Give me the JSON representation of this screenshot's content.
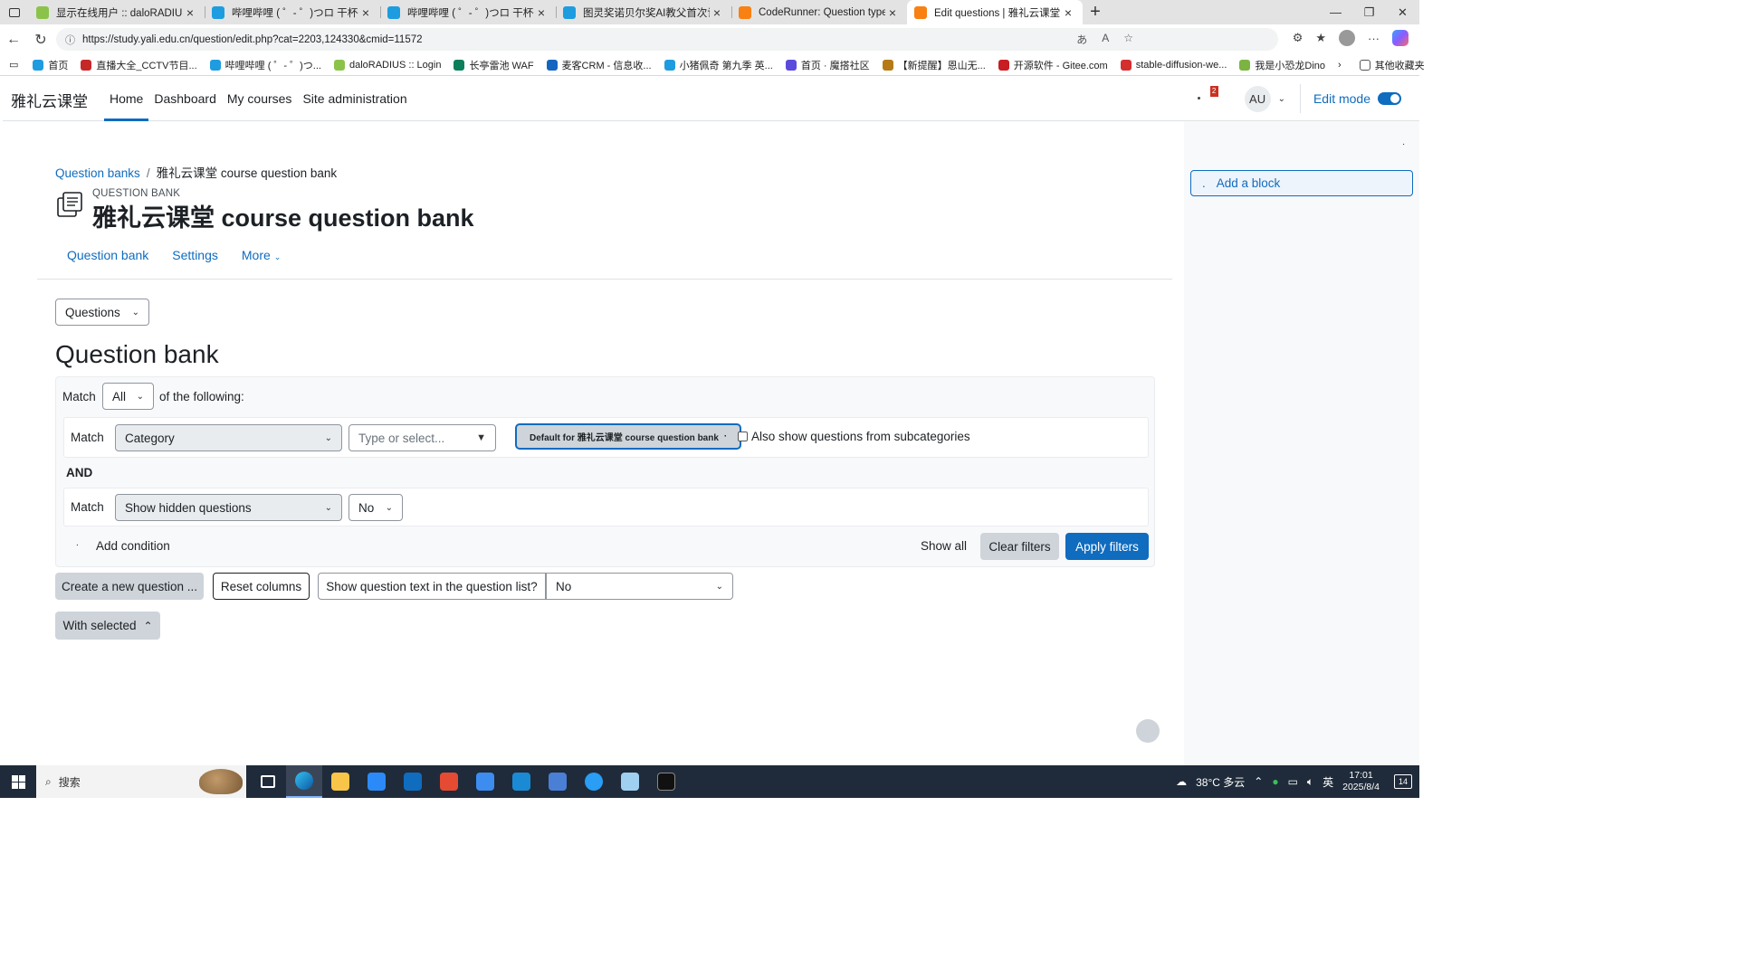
{
  "browser": {
    "tabs": [
      {
        "title": "显示在线用户 :: daloRADIUS",
        "color": "#8bc34a",
        "active": false
      },
      {
        "title": "哔哩哔哩 ( ゜- ゜)つロ 干杯~-bilib",
        "color": "#1e9ce0",
        "active": false
      },
      {
        "title": "哔哩哔哩 ( ゜- ゜)つロ 干杯~-bilib",
        "color": "#1e9ce0",
        "active": false
      },
      {
        "title": "图灵奖诺贝尔奖AI教父首次访华,",
        "color": "#1e9ce0",
        "active": false
      },
      {
        "title": "CodeRunner: Question type: Que",
        "color": "#f98012",
        "active": false
      },
      {
        "title": "Edit questions | 雅礼云课堂",
        "color": "#f98012",
        "active": true
      }
    ],
    "new_tab": "+",
    "url": "https://study.yali.edu.cn/question/edit.php?cat=2203,124330&cmid=11572",
    "bookmarks": [
      {
        "label": "首页",
        "color": "#1e9ce0"
      },
      {
        "label": "直播大全_CCTV节目...",
        "color": "#c62828"
      },
      {
        "label": "哔哩哔哩 ( ゜- ゜)つ...",
        "color": "#1e9ce0"
      },
      {
        "label": "daloRADIUS :: Login",
        "color": "#8bc34a"
      },
      {
        "label": "长亭雷池 WAF",
        "color": "#0a7f5a"
      },
      {
        "label": "麦客CRM - 信息收...",
        "color": "#1565c0"
      },
      {
        "label": "小猪佩奇 第九季 英...",
        "color": "#1e9ce0"
      },
      {
        "label": "首页 · 魔搭社区",
        "color": "#5b4bdb"
      },
      {
        "label": "【新提醒】恩山无...",
        "color": "#b57a16"
      },
      {
        "label": "开源软件 - Gitee.com",
        "color": "#c71d23"
      },
      {
        "label": "stable-diffusion-we...",
        "color": "#d32f2f"
      },
      {
        "label": "我是小恐龙Dino",
        "color": "#7cb342"
      }
    ],
    "other_bookmarks": "其他收藏夹"
  },
  "navbar": {
    "brand": "雅礼云课堂",
    "links": [
      "Home",
      "Dashboard",
      "My courses",
      "Site administration"
    ],
    "notification_count": "2",
    "avatar_initials": "AU",
    "edit_mode_label": "Edit mode",
    "edit_mode_on": true
  },
  "header": {
    "breadcrumb": [
      "Question banks",
      "雅礼云课堂 course question bank"
    ],
    "kicker": "QUESTION BANK",
    "title": "雅礼云课堂 course question bank",
    "secondary_nav": [
      "Question bank",
      "Settings",
      "More"
    ]
  },
  "main": {
    "page_select": "Questions",
    "heading": "Question bank",
    "filters": {
      "match_label": "Match",
      "match_value": "All",
      "of_following": "of the following:",
      "condition1": {
        "match_label": "Match",
        "field": "Category",
        "type_placeholder": "Type or select...",
        "chip": "Default for 雅礼云课堂 course question bank",
        "subcategories_label": "Also show questions from subcategories"
      },
      "joiner": "AND",
      "condition2": {
        "match_label": "Match",
        "field": "Show hidden questions",
        "value": "No"
      },
      "add_condition": "Add condition",
      "show_all": "Show all",
      "clear_filters": "Clear filters",
      "apply_filters": "Apply filters"
    },
    "create_question": "Create a new question ...",
    "reset_columns": "Reset columns",
    "show_text_label": "Show question text in the question list?",
    "show_text_value": "No",
    "with_selected": "With selected"
  },
  "drawer": {
    "add_block": "Add a block"
  },
  "taskbar": {
    "search_placeholder": "搜索",
    "weather": "38°C 多云",
    "ime": "英",
    "time": "17:01",
    "date": "2025/8/4",
    "notifications": "14"
  }
}
